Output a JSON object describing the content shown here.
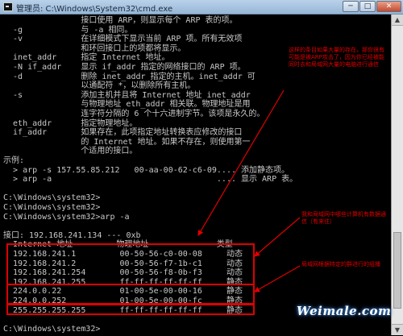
{
  "window": {
    "title": "管理员: C:\\Windows\\System32\\cmd.exe",
    "minimize": "─",
    "maximize": "□",
    "close": "✕"
  },
  "console_lines": [
    "                接口使用 ARP，则显示每个 ARP 表的项。",
    "  -g            与 -a 相同。",
    "  -v            在详细模式下显示当前 ARP 项。所有无效项",
    "                和环回接口上的项都将显示。",
    "  inet_addr     指定 Internet 地址。",
    "  -N if_addr    显示 if_addr 指定的网络接口的 ARP 项。",
    "  -d            删除 inet_addr 指定的主机。inet_addr 可",
    "                以通配符 *，以删除所有主机。",
    "  -s            添加主机并且将 Internet 地址 inet_addr",
    "                与物理地址 eth_addr 相关联。物理地址是用",
    "                连字符分隔的 6 个十六进制字节。该项是永久的。",
    "  eth_addr      指定物理地址。",
    "  if_addr       如果存在，此项指定地址转换表应修改的接口",
    "                的 Internet 地址。如果不存在，则使用第一",
    "                个适用的接口。",
    "示例:",
    "  > arp -s 157.55.85.212   00-aa-00-62-c6-09.... 添加静态项。",
    "  > arp -a                                  .... 显示 ARP 表。",
    "",
    "C:\\Windows\\system32>",
    "C:\\Windows\\system32>",
    "C:\\Windows\\system32>arp -a",
    "",
    "接口: 192.168.241.134 --- 0xb",
    "  Internet 地址         物理地址              类型",
    "  192.168.241.1         00-50-56-c0-00-08     动态",
    "  192.168.241.2         00-50-56-f7-1b-c1     动态",
    "  192.168.241.254       00-50-56-f8-0b-f3     动态",
    "  192.168.241.255       ff-ff-ff-ff-ff-ff     静态",
    "  224.0.0.22            01-00-5e-00-00-16     静态",
    "  224.0.0.252           01-00-5e-00-00-fc     静态",
    "  255.255.255.255       ff-ff-ff-ff-ff-ff     静态",
    "",
    "C:\\Windows\\system32>"
  ],
  "annotations": {
    "top_right": "这样的条目如果大量的存在，那你很有可能是被ARP攻击了，因为你已经被能同时去和局域网大量的电脑进行通信",
    "middle_right": "我和局域网中哪些计算机有数据通信（有来往）",
    "bottom_right": "局域网根据特定的群进行的组播"
  },
  "watermark": "Weimale.com",
  "colors": {
    "console_bg": "#000000",
    "console_text": "#c8c8c8",
    "annotation_red": "#e00000"
  }
}
